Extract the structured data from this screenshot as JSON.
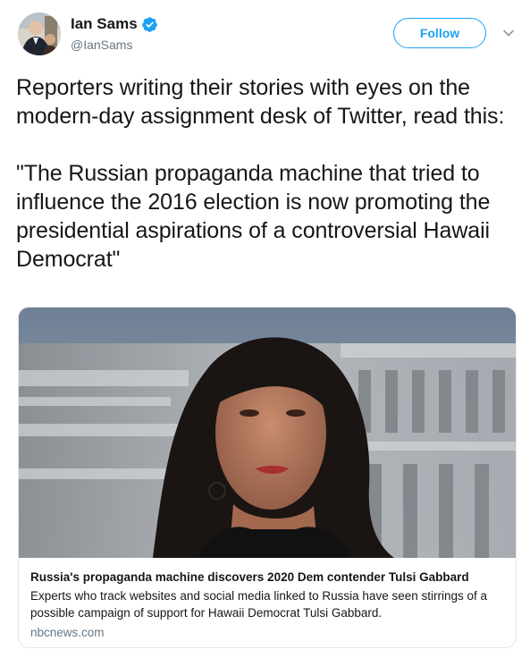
{
  "user": {
    "display_name": "Ian Sams",
    "handle": "@IanSams",
    "verified": true,
    "avatar_icon": "profile-photo"
  },
  "actions": {
    "follow_label": "Follow",
    "menu_icon": "chevron-down-icon"
  },
  "tweet": {
    "text": "Reporters writing their stories with eyes on the modern-day assignment desk of Twitter, read this:\n\n\"The Russian propaganda machine that tried to influence the 2016 election is now promoting the presidential aspirations of a controversial Hawaii Democrat\""
  },
  "card": {
    "title": "Russia's propaganda machine discovers 2020 Dem contender Tulsi Gabbard",
    "description": "Experts who track websites and social media linked to Russia have seen stirrings of a possible campaign of support for Hawaii Democrat Tulsi Gabbard.",
    "domain": "nbcnews.com",
    "image_icon": "article-photo"
  },
  "colors": {
    "accent": "#1da1f2",
    "text": "#14171a",
    "secondary_text": "#657786",
    "border": "#e1e8ed"
  }
}
